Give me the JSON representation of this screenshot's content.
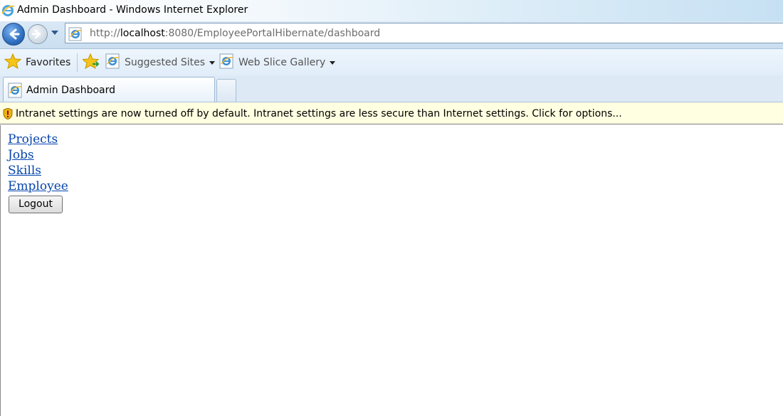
{
  "window": {
    "title": "Admin Dashboard - Windows Internet Explorer",
    "icon": "ie-logo-icon"
  },
  "address_bar": {
    "url_prefix": "http://",
    "url_host": "localhost",
    "url_rest": ":8080/EmployeePortalHibernate/dashboard"
  },
  "favorites_bar": {
    "favorites_label": "Favorites",
    "items": [
      {
        "label": "Suggested Sites",
        "icon": "ie-page-icon"
      },
      {
        "label": "Web Slice Gallery",
        "icon": "ie-page-icon"
      }
    ]
  },
  "tabs": [
    {
      "label": "Admin Dashboard",
      "active": true
    }
  ],
  "info_bar": {
    "message": "Intranet settings are now turned off by default. Intranet settings are less secure than Internet settings. Click for options..."
  },
  "page": {
    "links": [
      "Projects",
      "Jobs",
      "Skills",
      "Employee"
    ],
    "logout_label": "Logout"
  },
  "colors": {
    "link": "#0645ad",
    "info_bar_bg": "#ffffe1",
    "chrome_blue": "#dbe9f6"
  }
}
